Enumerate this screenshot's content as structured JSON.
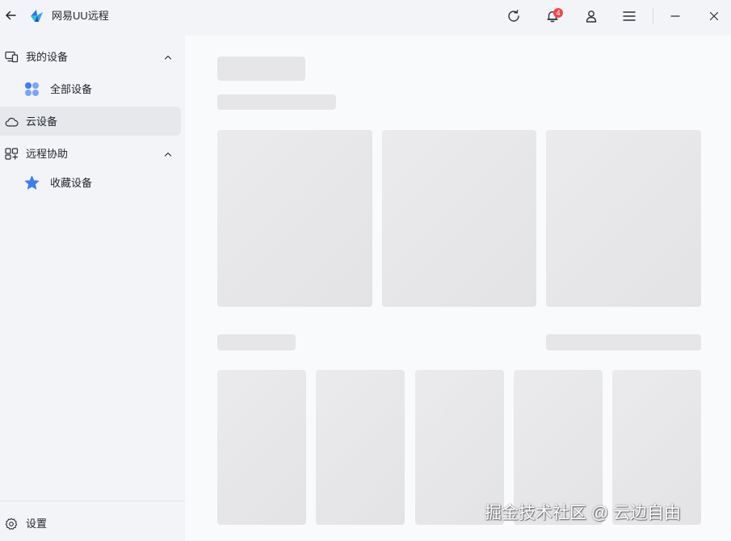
{
  "app": {
    "title": "网易UU远程",
    "notification_count": "4"
  },
  "titlebar": {
    "icons": [
      "back-arrow-icon",
      "app-logo-icon",
      "refresh-icon",
      "bell-icon",
      "user-icon",
      "menu-icon",
      "minimize-icon",
      "close-icon"
    ]
  },
  "sidebar": {
    "my_devices": {
      "label": "我的设备",
      "icon": "devices-icon"
    },
    "all_devices": {
      "label": "全部设备",
      "icon": "grid-dots-icon"
    },
    "cloud_devices": {
      "label": "云设备",
      "icon": "cloud-icon"
    },
    "remote_assist": {
      "label": "远程协助",
      "icon": "remote-assist-icon"
    },
    "favorites": {
      "label": "收藏设备",
      "icon": "star-icon"
    },
    "settings": {
      "label": "设置",
      "icon": "gear-icon"
    }
  },
  "colors": {
    "accent": "#3f7cf6",
    "badge": "#f2464a",
    "skeleton": "#e6e6e8",
    "sidebar_bg": "#f3f4f7",
    "main_bg": "#f9fafc"
  },
  "watermark": {
    "text": "掘金技术社区 @ 云边自由"
  }
}
